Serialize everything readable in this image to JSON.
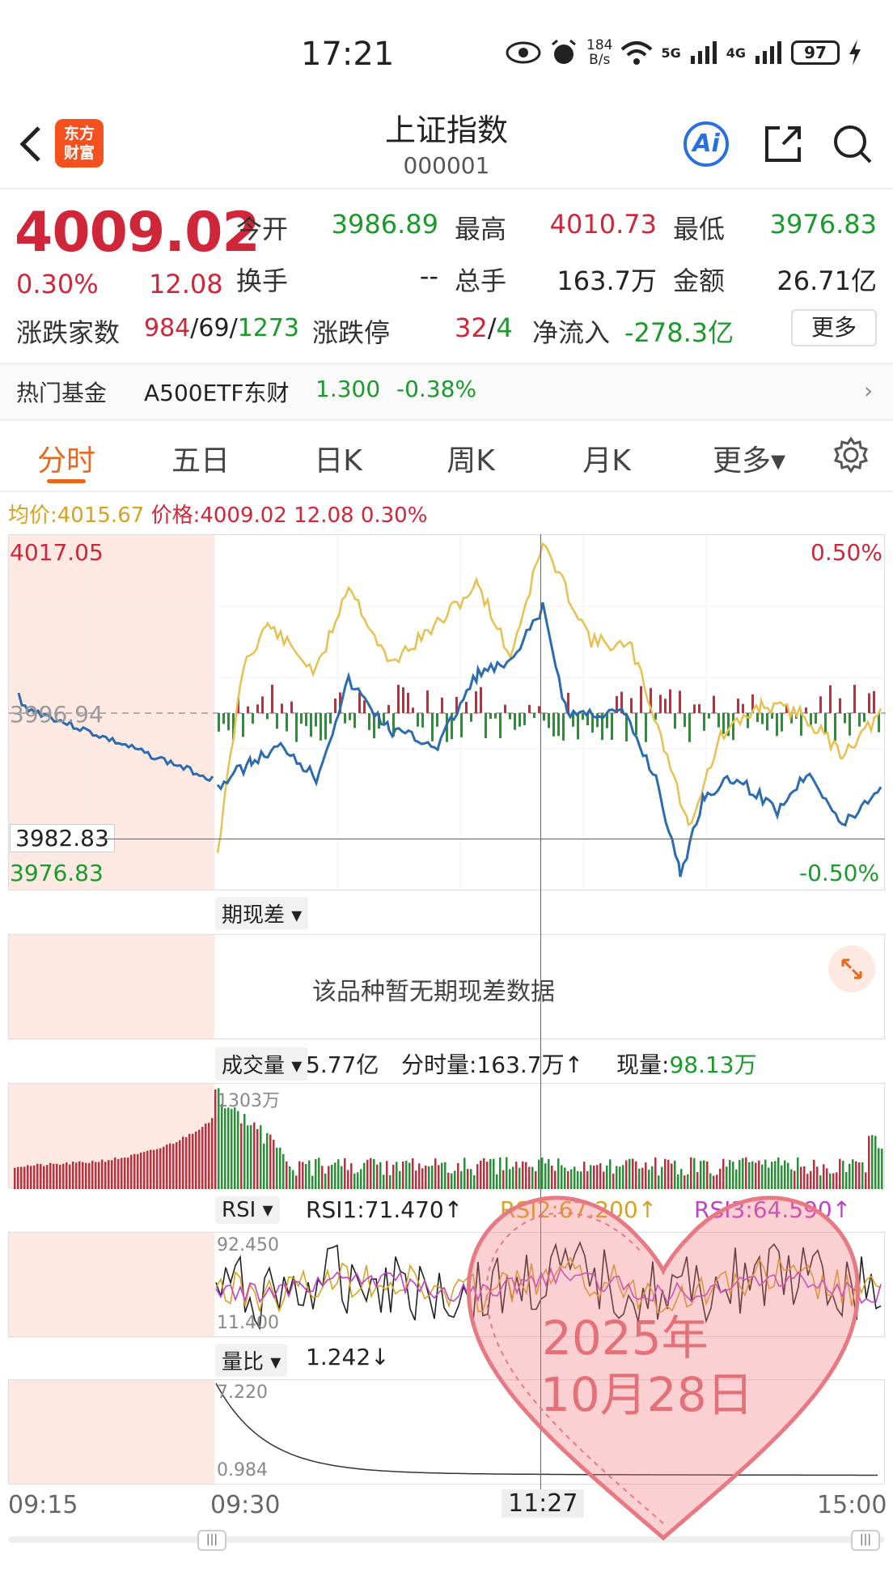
{
  "status_bar": {
    "time": "17:21",
    "net_speed_top": "184",
    "net_speed_bottom": "B/s",
    "net1": "5G",
    "net2": "4G",
    "battery": "97"
  },
  "header": {
    "title": "上证指数",
    "code": "000001",
    "logo_text_1": "东方",
    "logo_text_2": "财富",
    "ai_label": "Ai"
  },
  "quote": {
    "price": "4009.02",
    "pct": "0.30%",
    "change": "12.08",
    "open_label": "今开",
    "open": "3986.89",
    "high_label": "最高",
    "high": "4010.73",
    "low_label": "最低",
    "low": "3976.83",
    "turnover_label": "换手",
    "turnover": "--",
    "volume_label": "总手",
    "volume": "163.7万",
    "amount_label": "金额",
    "amount": "26.71亿",
    "breadth_label": "涨跌家数",
    "breadth_up": "984",
    "breadth_flat": "69",
    "breadth_down": "1273",
    "limit_label": "涨跌停",
    "limit_up": "32",
    "limit_down": "4",
    "netflow_label": "净流入",
    "netflow": "-278.3亿",
    "more": "更多",
    "sep": "/"
  },
  "hot_fund": {
    "label": "热门基金",
    "name": "A500ETF东财",
    "price": "1.300",
    "pct": "-0.38%"
  },
  "tabs": [
    "分时",
    "五日",
    "日K",
    "周K",
    "月K",
    "更多▾"
  ],
  "info": {
    "avg_label": "均价:",
    "avg": "4015.67",
    "price_label": "价格:",
    "price": "4009.02",
    "chg": "12.08",
    "pct": "0.30%"
  },
  "main_chart": {
    "top_value": "4017.05",
    "top_pct": "0.50%",
    "mid_value": "3996.94",
    "cross_value": "3982.83",
    "bottom_value": "3976.83",
    "bottom_pct": "-0.50%"
  },
  "basis": {
    "dropdown": "期现差",
    "empty_text": "该品种暂无期现差数据"
  },
  "volume": {
    "dropdown": "成交量",
    "total": "5.77亿",
    "fs_label": "分时量:163.7万↑",
    "now_label": "现量:",
    "now": "98.13万",
    "max": "1303万"
  },
  "rsi": {
    "dropdown": "RSI",
    "rsi1": "RSI1:71.470↑",
    "rsi2": "RSI2:67.200↑",
    "rsi3": "RSI3:64.590↑",
    "max": "92.450",
    "min": "11.400"
  },
  "ratio": {
    "dropdown": "量比",
    "value": "1.242↓",
    "max": "7.220",
    "min": "0.984"
  },
  "time_axis": [
    "09:15",
    "09:30",
    "11:27",
    "15:00"
  ],
  "stamp": {
    "line1": "2025年",
    "line2": "10月28日"
  },
  "colors": {
    "up": "#d0263a",
    "down": "#1a9a2a",
    "avg": "#d9a21e",
    "price_line": "#2b6cb0",
    "accent": "#e8671b"
  }
}
